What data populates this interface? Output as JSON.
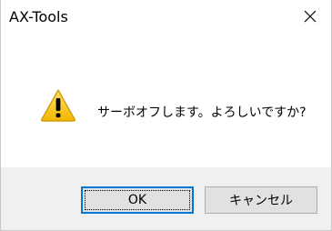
{
  "window": {
    "title": "AX-Tools",
    "close_icon": "close-icon"
  },
  "dialog": {
    "icon": "warning-icon",
    "message": "サーボオフします。よろしいですか?"
  },
  "buttons": {
    "ok_label": "OK",
    "cancel_label": "キャンセル"
  },
  "colors": {
    "footer_bg": "#f0f0f0",
    "button_bg": "#e1e1e1",
    "focus_border": "#0078d7",
    "warning_yellow": "#f7c200"
  }
}
